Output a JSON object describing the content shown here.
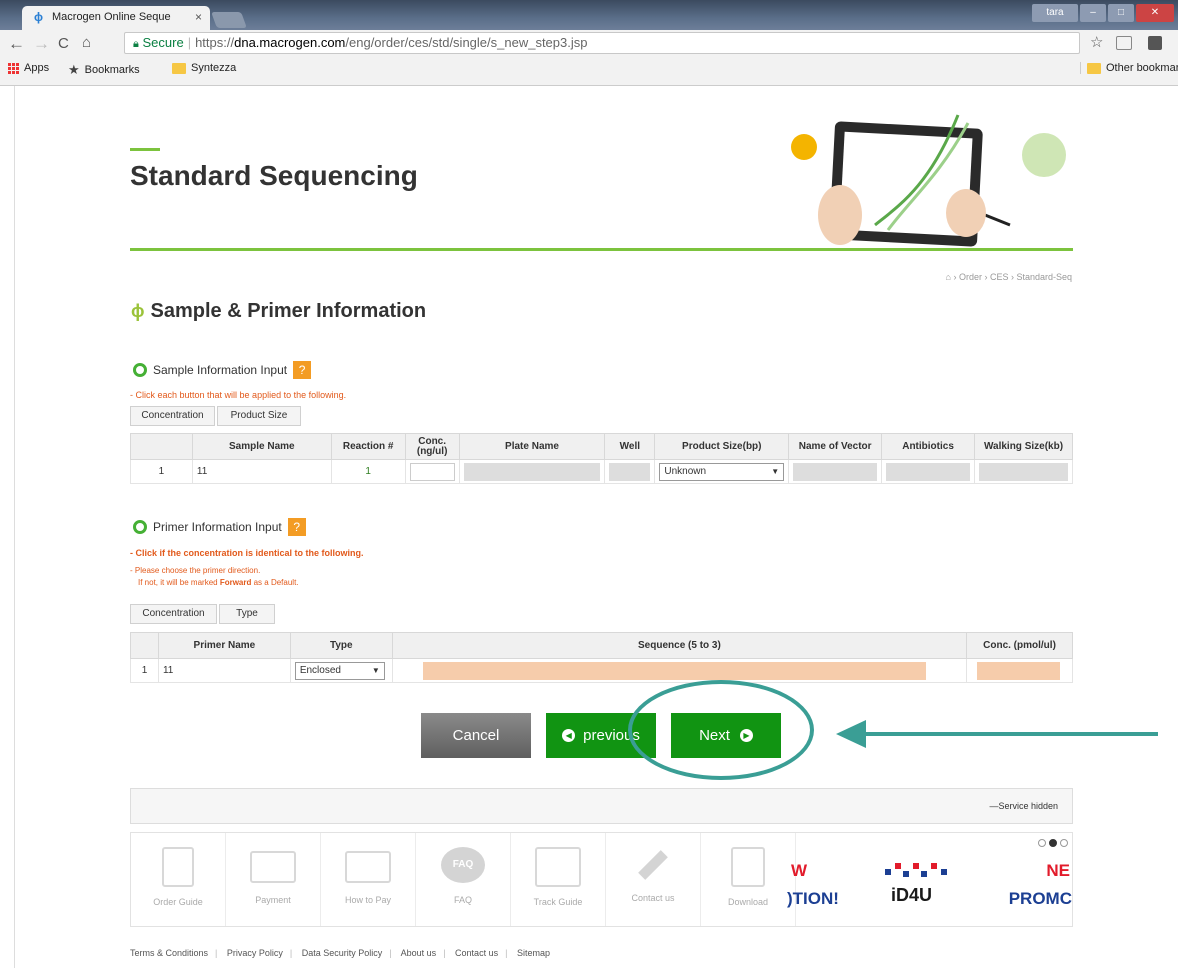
{
  "browser": {
    "tab_title": "Macrogen Online Seque",
    "tab_close": "×",
    "window_user": "tara",
    "url_secure": "Secure",
    "url_scheme": "https://",
    "url_host": "dna.macrogen.com",
    "url_path": "/eng/order/ces/std/single/s_new_step3.jsp",
    "bookmarks": [
      "Apps",
      "Bookmarks",
      "Syntezza"
    ],
    "other_bookmarks": "Other bookmar"
  },
  "page": {
    "title": "Standard Sequencing",
    "breadcrumb": "⌂ › Order › CES › Standard-Seq",
    "section_title": "Sample & Primer Information"
  },
  "sample_section": {
    "title": "Sample Information Input",
    "help": "?",
    "note": "- Click each button that will be applied to the following.",
    "buttons": [
      "Concentration",
      "Product Size"
    ],
    "headers": [
      "",
      "Sample Name",
      "Reaction #",
      "Conc. (ng/ul)",
      "Plate Name",
      "Well",
      "Product Size(bp)",
      "Name of Vector",
      "Antibiotics",
      "Walking Size(kb)"
    ],
    "rows": [
      {
        "no": "1",
        "sample_name": "11",
        "reaction": "1",
        "product_size": "Unknown"
      }
    ]
  },
  "primer_section": {
    "title": "Primer Information Input",
    "help": "?",
    "note1": "- Click if the concentration is identical to the following.",
    "note2": "- Please choose the primer direction.",
    "note3_prefix": "If not, it will be marked ",
    "note3_strong": "Forward",
    "note3_suffix": " as a Default.",
    "buttons": [
      "Concentration",
      "Type"
    ],
    "headers": [
      "",
      "Primer Name",
      "Type",
      "Sequence (5 to 3)",
      "Conc. (pmol/ul)"
    ],
    "rows": [
      {
        "no": "1",
        "primer_name": "11",
        "type": "Enclosed"
      }
    ]
  },
  "actions": {
    "cancel": "Cancel",
    "previous": "previous",
    "next": "Next"
  },
  "service_bar": {
    "label": "—Service hidden"
  },
  "quick_menu": [
    "Order Guide",
    "Payment",
    "How to Pay",
    "FAQ",
    "Track Guide",
    "Contact us",
    "Download"
  ],
  "faq_icon_text": "FAQ",
  "banners": {
    "left_top": "W",
    "left_bottom": ")TION!",
    "middle": "iD4U",
    "right_top": "NE",
    "right_bottom": "PROMC"
  },
  "footer": [
    "Terms & Conditions",
    "Privacy Policy",
    "Data Security Policy",
    "About us",
    "Contact us",
    "Sitemap"
  ],
  "colors": {
    "accent_green": "#7cc33e",
    "button_green": "#119412",
    "note_orange": "#e25a1c",
    "annotation_teal": "#3a9e95"
  }
}
